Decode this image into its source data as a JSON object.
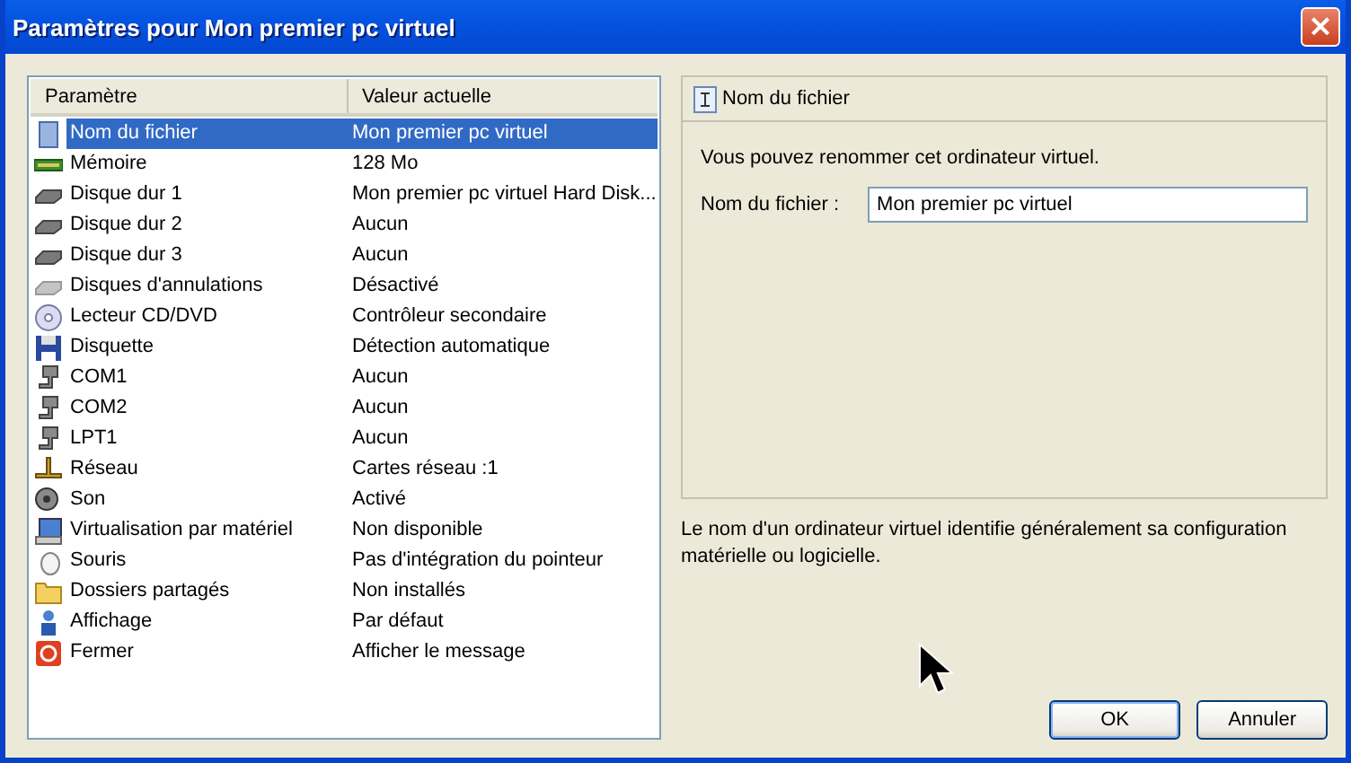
{
  "window": {
    "title": "Paramètres pour Mon premier pc virtuel",
    "close": "×"
  },
  "table": {
    "columns": [
      "Paramètre",
      "Valeur actuelle"
    ],
    "rows": [
      {
        "kind": "file",
        "name": "Nom du fichier",
        "value": "Mon premier pc virtuel",
        "selected": true
      },
      {
        "kind": "memory",
        "name": "Mémoire",
        "value": "128 Mo",
        "selected": false
      },
      {
        "kind": "disk",
        "name": "Disque dur 1",
        "value": "Mon premier pc virtuel Hard Disk...",
        "selected": false
      },
      {
        "kind": "disk",
        "name": "Disque dur 2",
        "value": "Aucun",
        "selected": false
      },
      {
        "kind": "disk",
        "name": "Disque dur 3",
        "value": "Aucun",
        "selected": false
      },
      {
        "kind": "undo-disk",
        "name": "Disques d'annulations",
        "value": "Désactivé",
        "selected": false
      },
      {
        "kind": "cd",
        "name": "Lecteur CD/DVD",
        "value": "Contrôleur secondaire",
        "selected": false
      },
      {
        "kind": "floppy",
        "name": "Disquette",
        "value": "Détection automatique",
        "selected": false
      },
      {
        "kind": "port",
        "name": "COM1",
        "value": "Aucun",
        "selected": false
      },
      {
        "kind": "port",
        "name": "COM2",
        "value": "Aucun",
        "selected": false
      },
      {
        "kind": "port",
        "name": "LPT1",
        "value": "Aucun",
        "selected": false
      },
      {
        "kind": "network",
        "name": "Réseau",
        "value": "Cartes réseau :1",
        "selected": false
      },
      {
        "kind": "sound",
        "name": "Son",
        "value": "Activé",
        "selected": false
      },
      {
        "kind": "hardware",
        "name": "Virtualisation par matériel",
        "value": "Non disponible",
        "selected": false
      },
      {
        "kind": "mouse",
        "name": "Souris",
        "value": "Pas d'intégration du pointeur",
        "selected": false
      },
      {
        "kind": "folder",
        "name": "Dossiers partagés",
        "value": "Non installés",
        "selected": false
      },
      {
        "kind": "display",
        "name": "Affichage",
        "value": "Par défaut",
        "selected": false
      },
      {
        "kind": "power",
        "name": "Fermer",
        "value": "Afficher le message",
        "selected": false
      }
    ]
  },
  "detail": {
    "title": "Nom du fichier",
    "intro": "Vous pouvez renommer cet ordinateur virtuel.",
    "field_label": "Nom du fichier :",
    "field_value": "Mon premier pc virtuel"
  },
  "description": "Le nom d'un ordinateur virtuel identifie généralement sa configuration matérielle ou logicielle.",
  "buttons": [
    "OK",
    "Annuler"
  ]
}
